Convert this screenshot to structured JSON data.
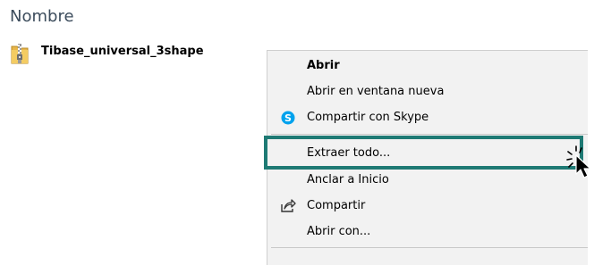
{
  "explorer": {
    "column_header": "Nombre",
    "file": {
      "name": "Tibase_universal_3shape",
      "icon": "zip-folder-icon"
    }
  },
  "context_menu": {
    "items": [
      {
        "label": "Abrir",
        "bold": true
      },
      {
        "label": "Abrir en ventana nueva"
      },
      {
        "label": "Compartir con Skype",
        "icon": "skype-icon"
      },
      {
        "label": "Extraer todo...",
        "highlighted": true
      },
      {
        "label": "Anclar a Inicio"
      },
      {
        "label": "Compartir",
        "icon": "share-icon"
      },
      {
        "label": "Abrir con..."
      }
    ]
  },
  "colors": {
    "highlight_border": "#1e7a74",
    "menu_background": "#f2f2f2",
    "skype_blue": "#00a2ed"
  }
}
